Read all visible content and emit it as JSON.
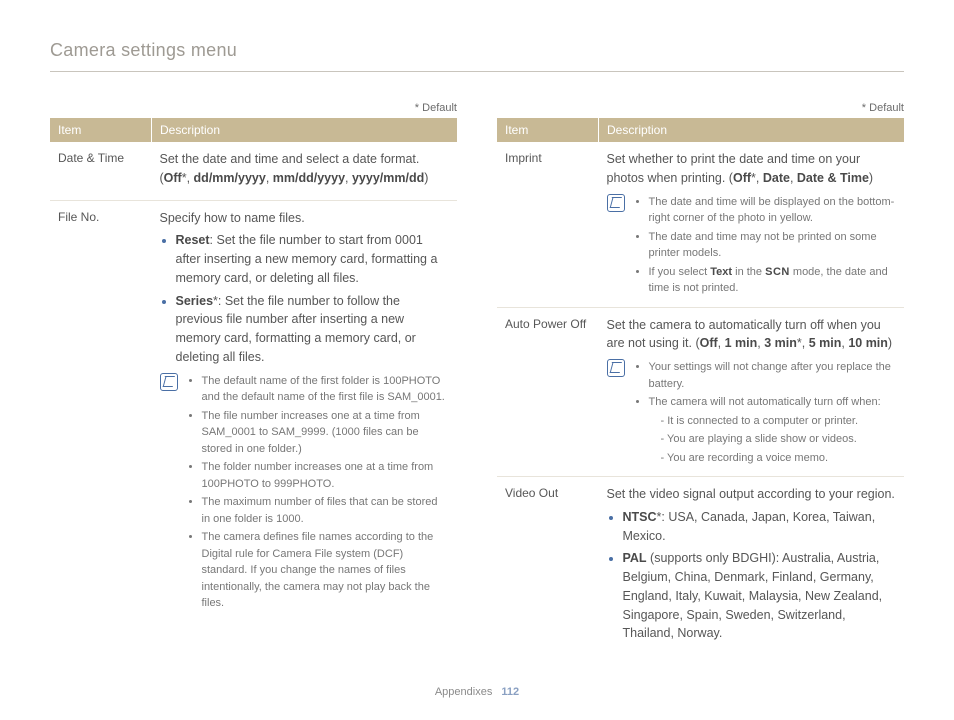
{
  "page": {
    "title": "Camera settings menu",
    "defaultNote": "* Default",
    "footerChapter": "Appendixes",
    "footerPage": "112"
  },
  "headers": {
    "item": "Item",
    "description": "Description"
  },
  "left": {
    "dateTime": {
      "item": "Date & Time",
      "intro": "Set the date and time and select a date format.",
      "optionsPrefix": "(",
      "optOff": "Off",
      "sep1": "*, ",
      "opt2": "dd/mm/yyyy",
      "sep2": ", ",
      "opt3": "mm/dd/yyyy",
      "sep3": ", ",
      "opt4": "yyyy/mm/dd",
      "optionsSuffix": ")"
    },
    "fileNo": {
      "item": "File No.",
      "intro": "Specify how to name files.",
      "resetLabel": "Reset",
      "resetText": ": Set the file number to start from 0001 after inserting a new memory card, formatting a memory card, or deleting all files.",
      "seriesLabel": "Series",
      "seriesText": "*: Set the file number to follow the previous file number after inserting a new memory card, formatting a memory card, or deleting all files.",
      "note1": "The default name of the first folder is 100PHOTO and the default name of the first file is SAM_0001.",
      "note2": "The file number increases one at a time from SAM_0001 to SAM_9999. (1000 files can be stored in one folder.)",
      "note3": "The folder number increases one at a time from 100PHOTO to 999PHOTO.",
      "note4": "The maximum number of files that can be stored in one folder is 1000.",
      "note5": "The camera defines file names according to the Digital rule for Camera File system (DCF) standard. If you change the names of files intentionally, the camera may not play back the files."
    }
  },
  "right": {
    "imprint": {
      "item": "Imprint",
      "introA": "Set whether to print the date and time on your photos when printing. (",
      "optOff": "Off",
      "sep1": "*, ",
      "optDate": "Date",
      "sep2": ", ",
      "optDT": "Date & Time",
      "introB": ")",
      "note1": "The date and time will be displayed on the bottom-right corner of the photo in yellow.",
      "note2": "The date and time may not be printed on some printer models.",
      "note3a": "If you select ",
      "note3Text": "Text",
      "note3b": " in the ",
      "note3Scn": "SCN",
      "note3c": " mode, the date and time is not printed."
    },
    "autoPower": {
      "item": "Auto Power Off",
      "introA": "Set the camera to automatically turn off when you are not using it. (",
      "optOff": "Off",
      "s1": ", ",
      "opt1": "1 min",
      "s2": ", ",
      "opt3": "3 min",
      "s3": "*, ",
      "opt5": "5 min",
      "s4": ", ",
      "opt10": "10 min",
      "introB": ")",
      "note1": "Your settings will not change after you replace the battery.",
      "note2": "The camera will not automatically turn off when:",
      "sub1": "It is connected to a computer or printer.",
      "sub2": "You are playing a slide show or videos.",
      "sub3": "You are recording a voice memo."
    },
    "videoOut": {
      "item": "Video Out",
      "intro": "Set the video signal output according to your region.",
      "ntscLabel": "NTSC",
      "ntscText": "*: USA, Canada, Japan, Korea, Taiwan, Mexico.",
      "palLabel": "PAL",
      "palText": " (supports only BDGHI): Australia, Austria, Belgium, China, Denmark, Finland, Germany, England, Italy, Kuwait, Malaysia, New Zealand, Singapore, Spain, Sweden, Switzerland, Thailand, Norway."
    }
  }
}
